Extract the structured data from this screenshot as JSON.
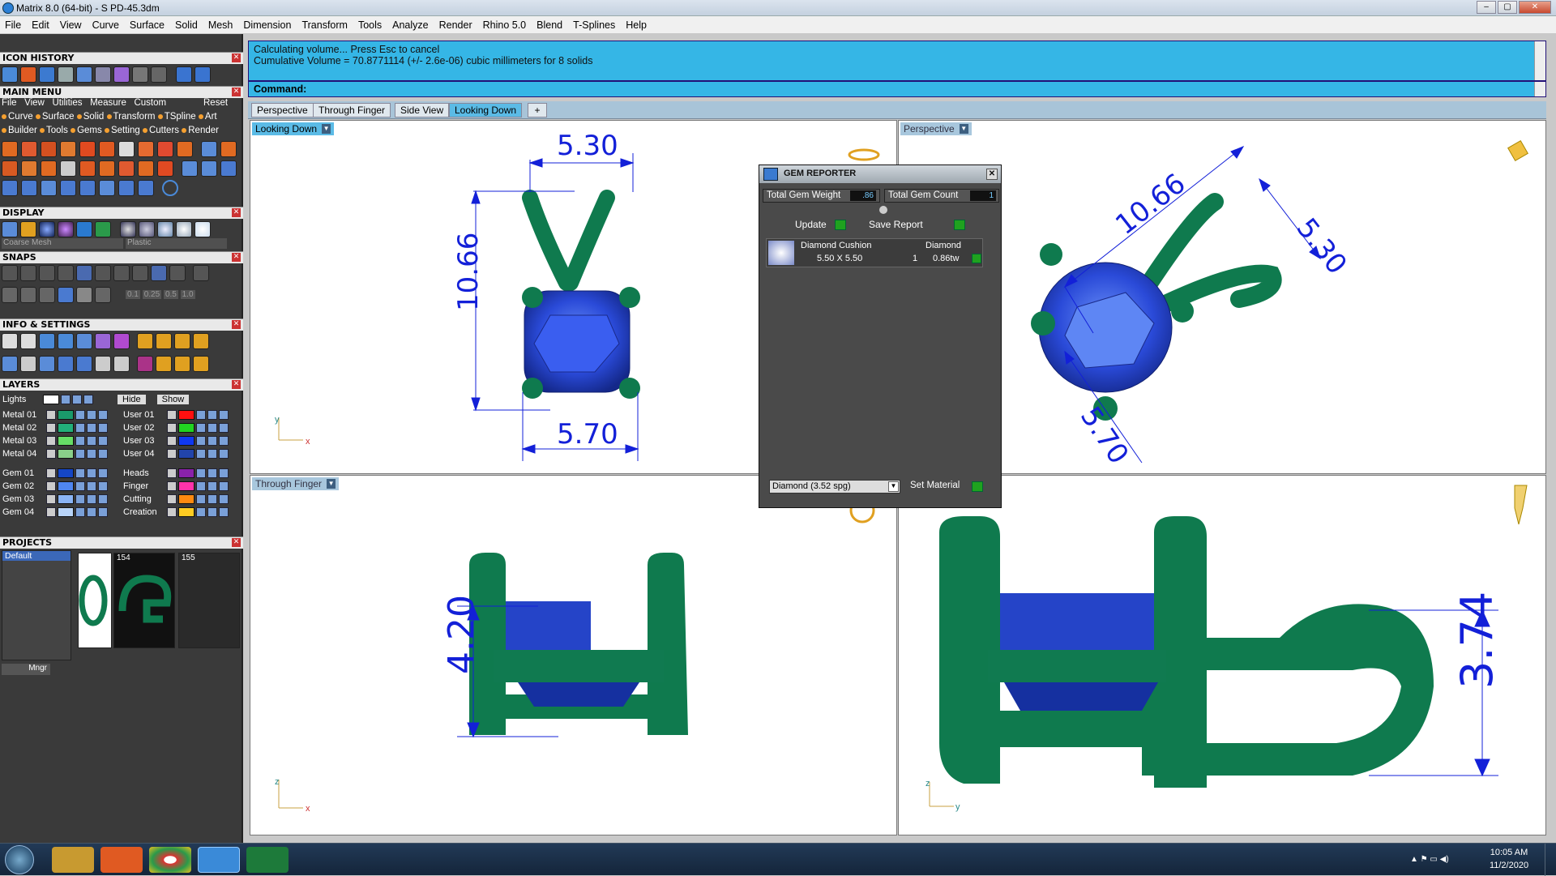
{
  "window": {
    "title": "Matrix 8.0 (64-bit) - S PD-45.3dm"
  },
  "menubar": [
    "File",
    "Edit",
    "View",
    "Curve",
    "Surface",
    "Solid",
    "Mesh",
    "Dimension",
    "Transform",
    "Tools",
    "Analyze",
    "Render",
    "Rhino 5.0",
    "Blend",
    "T-Splines",
    "Help"
  ],
  "left_panel": {
    "icon_history": "ICON HISTORY",
    "main_menu": "MAIN MENU",
    "main_menu_row1": [
      "File",
      "View",
      "Utilities",
      "Measure",
      "Custom"
    ],
    "reset": "Reset",
    "main_menu_row2": [
      "Curve",
      "Surface",
      "Solid",
      "Transform",
      "TSpline",
      "Art"
    ],
    "main_menu_row3": [
      "Builder",
      "Tools",
      "Gems",
      "Setting",
      "Cutters",
      "Render"
    ],
    "display": "DISPLAY",
    "display_modes": [
      "Coarse Mesh",
      "Plastic"
    ],
    "snaps": "SNAPS",
    "snap_values": [
      "0.1",
      "0.25",
      "0.5",
      "1.0"
    ],
    "info_settings": "INFO & SETTINGS",
    "layers": "LAYERS",
    "lights": "Lights",
    "hide": "Hide",
    "show": "Show",
    "layers_left": [
      {
        "name": "Metal 01",
        "color": "#1a9a6a"
      },
      {
        "name": "Metal 02",
        "color": "#22b07a"
      },
      {
        "name": "Metal 03",
        "color": "#66dd66"
      },
      {
        "name": "Metal 04",
        "color": "#8ad08a"
      },
      {
        "name": "Gem 01",
        "color": "#1546c4"
      },
      {
        "name": "Gem 02",
        "color": "#4f86f0"
      },
      {
        "name": "Gem 03",
        "color": "#8ab4f5"
      },
      {
        "name": "Gem 04",
        "color": "#b8d4f8"
      }
    ],
    "layers_right": [
      {
        "name": "User 01",
        "color": "#ff1010"
      },
      {
        "name": "User 02",
        "color": "#21d321"
      },
      {
        "name": "User 03",
        "color": "#1038f0"
      },
      {
        "name": "User 04",
        "color": "#2244aa"
      },
      {
        "name": "Heads",
        "color": "#8a22aa"
      },
      {
        "name": "Finger",
        "color": "#ff33aa"
      },
      {
        "name": "Cutting",
        "color": "#ff8a10"
      },
      {
        "name": "Creation",
        "color": "#ffcc22"
      }
    ],
    "projects": "PROJECTS",
    "project_default": "Default",
    "project_thumbs": [
      "154",
      "155"
    ],
    "mngr": "Mngr"
  },
  "command": {
    "line1": "Calculating volume... Press Esc to cancel",
    "line2": "Cumulative Volume = 70.8771114 (+/- 2.6e-06) cubic millimeters for 8 solids",
    "prompt": "Command:"
  },
  "viewport_tabs": [
    "Perspective",
    "Through Finger",
    "Side View",
    "Looking Down"
  ],
  "viewports": {
    "top_left": {
      "label": "Looking Down",
      "dims": [
        "5.30",
        "10.66",
        "5.70"
      ],
      "axis_y": "y",
      "axis_x": "x"
    },
    "top_right": {
      "label": "Perspective",
      "dims": [
        "10.66",
        "5.30",
        "5.70"
      ]
    },
    "bottom_left": {
      "label": "Through Finger",
      "dims": [
        "4.20"
      ],
      "axis_y": "z",
      "axis_x": "x"
    },
    "bottom_right": {
      "dims": [
        "3.74"
      ],
      "axis_y": "z",
      "axis_x": "y"
    }
  },
  "gem_reporter": {
    "title": "GEM REPORTER",
    "total_weight_label": "Total Gem Weight",
    "total_weight": ".86",
    "total_count_label": "Total Gem Count",
    "total_count": "1",
    "update": "Update",
    "save_report": "Save Report",
    "gem_shape": "Diamond Cushion",
    "gem_material": "Diamond",
    "gem_size": "5.50 X 5.50",
    "gem_qty": "1",
    "gem_weight": "0.86tw",
    "material_select": "Diamond      (3.52 spg)",
    "set_material": "Set Material"
  },
  "taskbar": {
    "time": "10:05 AM",
    "date": "11/2/2020"
  },
  "colors": {
    "metal": "#0f7a4e",
    "gem": "#1a3ec8",
    "dims": "#1320d8",
    "panel": "#3a3a3a",
    "command_bg": "#35b6e6"
  }
}
